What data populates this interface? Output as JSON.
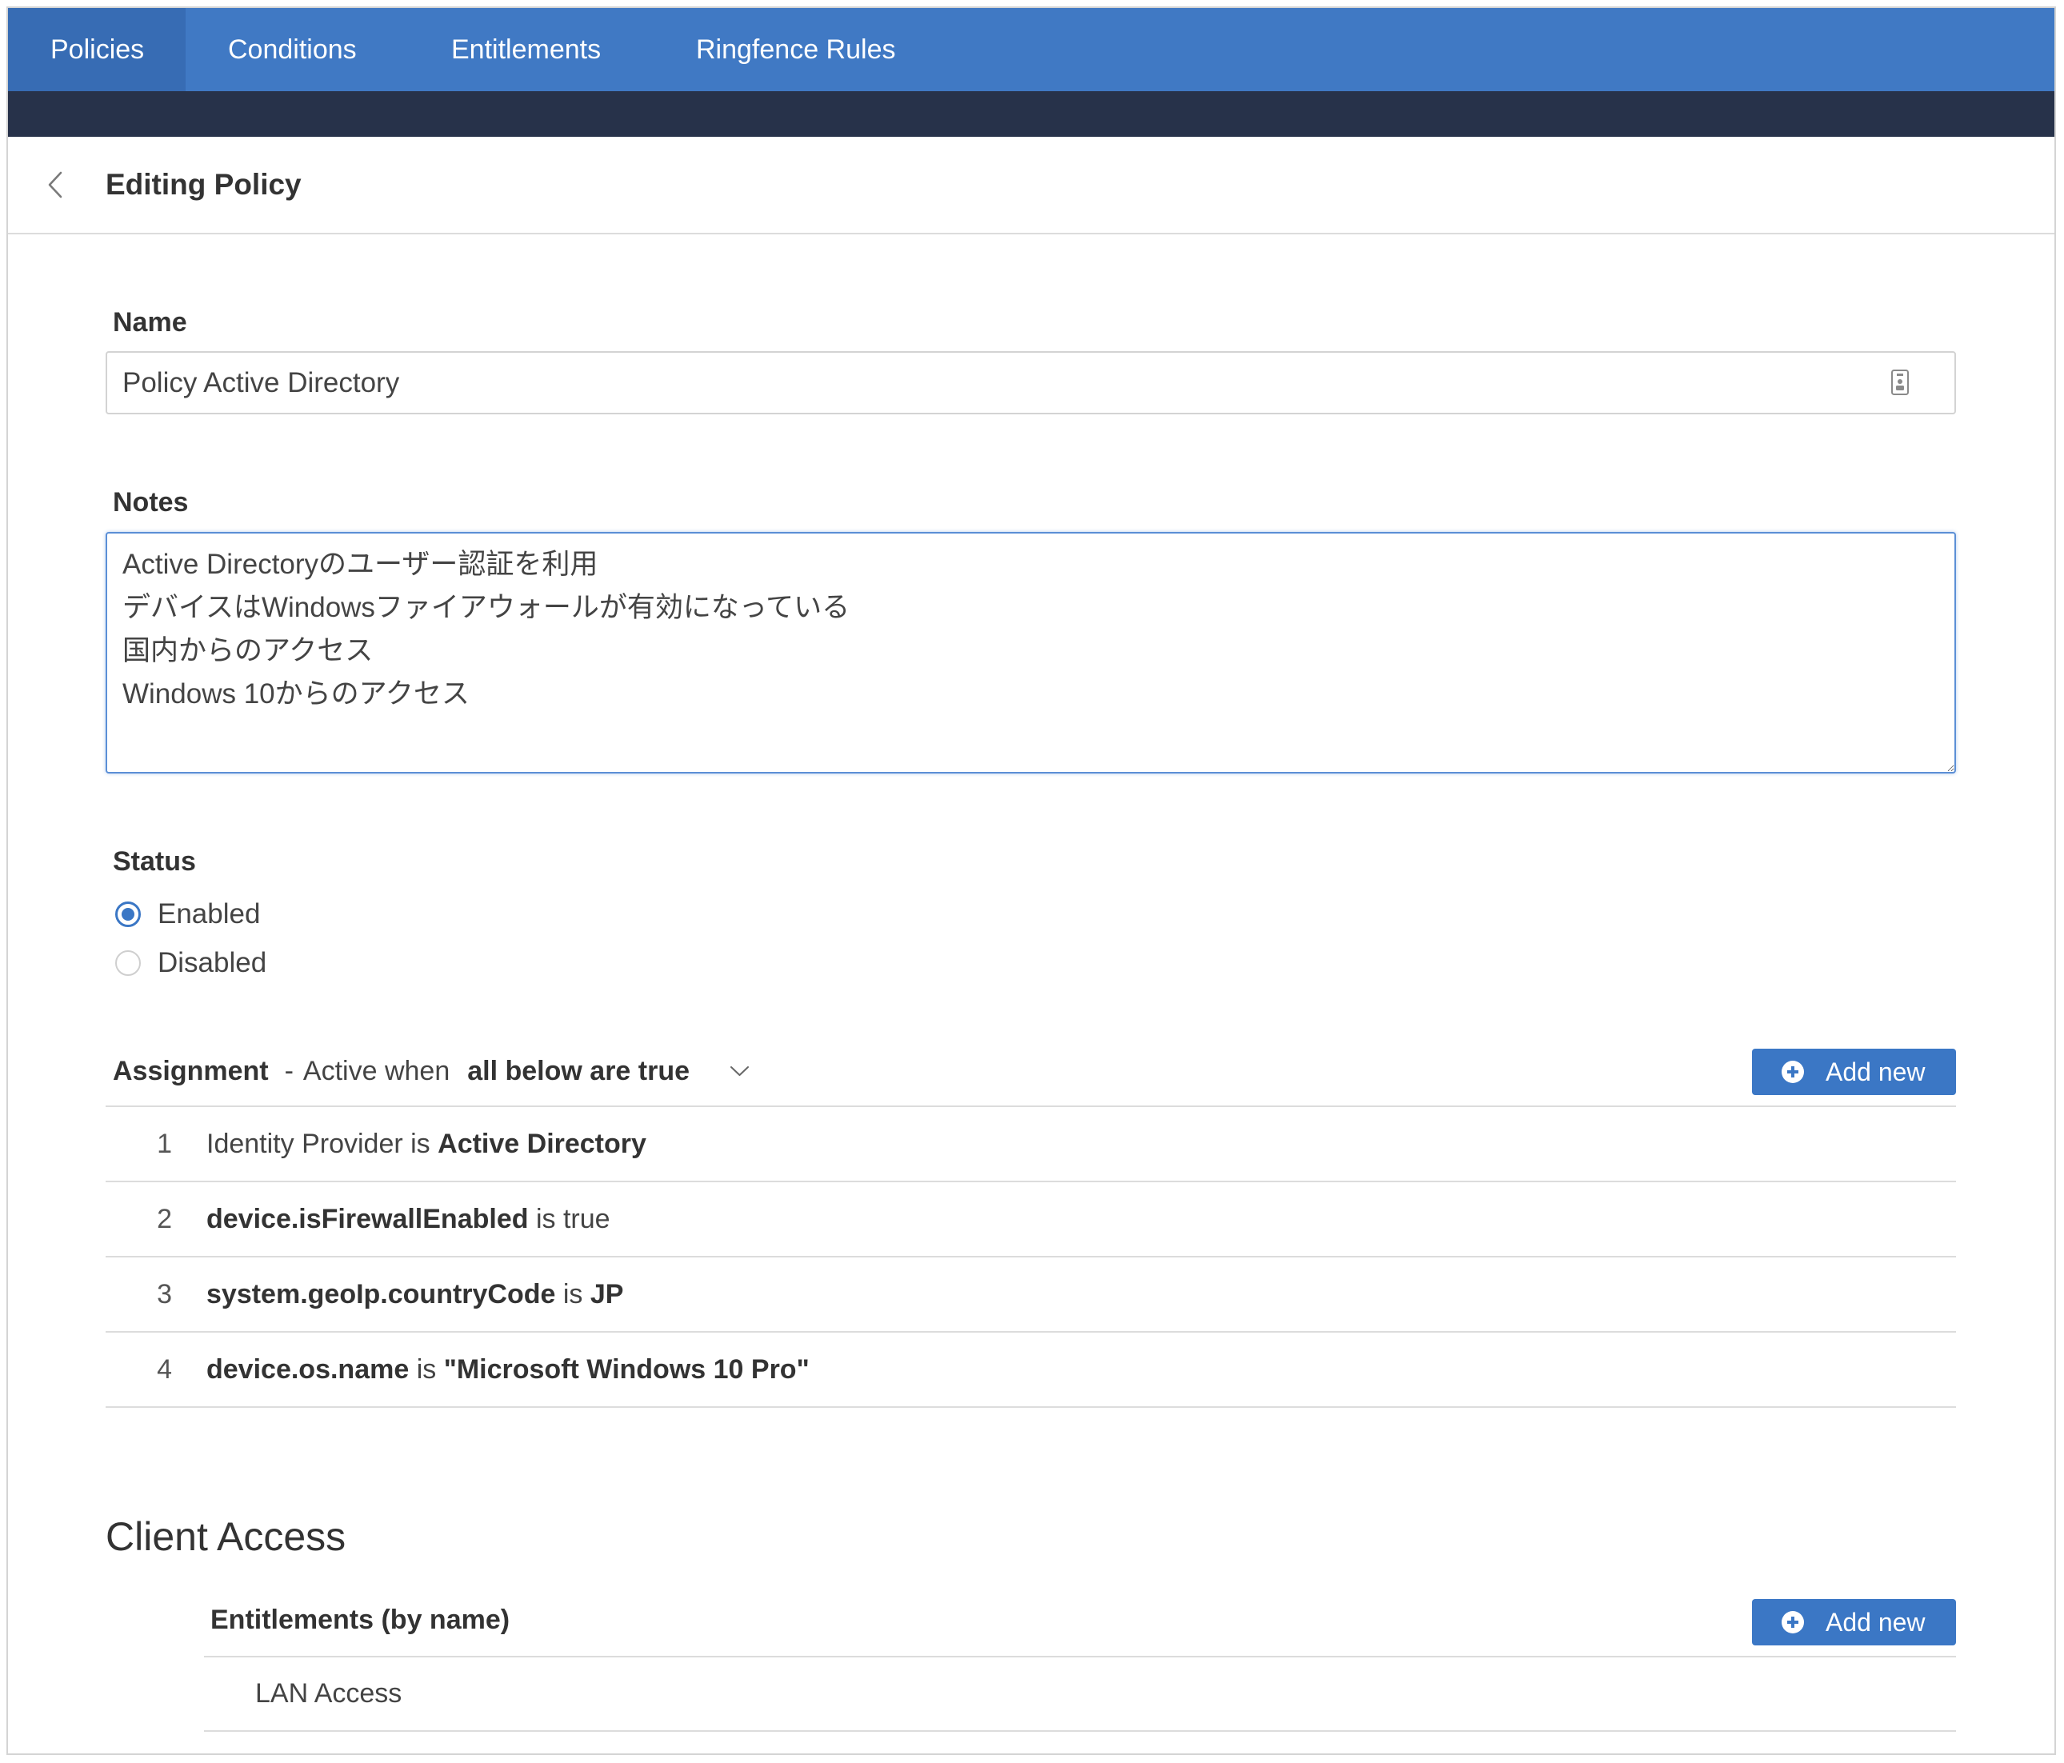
{
  "theme": {
    "nav_bg": "#4079c4",
    "nav_active_bg": "#376cb4",
    "band_bg": "#27324a",
    "accent": "#3b77c5",
    "focus_border": "#5b8fd6",
    "divider": "#dcdcdc"
  },
  "icons": {
    "back": "chevron-left-icon",
    "autofill": "autofill-icon",
    "dropdown": "chevron-down-icon",
    "add": "plus-circle-icon"
  },
  "nav": {
    "tabs": [
      {
        "label": "Policies",
        "active": true
      },
      {
        "label": "Conditions",
        "active": false
      },
      {
        "label": "Entitlements",
        "active": false
      },
      {
        "label": "Ringfence Rules",
        "active": false
      }
    ]
  },
  "header": {
    "title": "Editing Policy"
  },
  "form": {
    "name": {
      "label": "Name",
      "value": "Policy Active Directory"
    },
    "notes": {
      "label": "Notes",
      "value": "Active Directoryのユーザー認証を利用\nデバイスはWindowsファイアウォールが有効になっている\n国内からのアクセス\nWindows 10からのアクセス"
    },
    "status": {
      "label": "Status",
      "options": [
        {
          "label": "Enabled",
          "selected": true
        },
        {
          "label": "Disabled",
          "selected": false
        }
      ]
    }
  },
  "assignment": {
    "label": "Assignment",
    "separator": "-",
    "active_when": "Active when",
    "mode": "all below are true",
    "add_button": "Add new",
    "conditions": [
      {
        "index": "1",
        "subject": "Identity Provider",
        "operator": "is",
        "value": "Active Directory"
      },
      {
        "index": "2",
        "subject": "device.isFirewallEnabled",
        "operator": "is",
        "value": "true"
      },
      {
        "index": "3",
        "subject": "system.geoIp.countryCode",
        "operator": "is",
        "value": "JP"
      },
      {
        "index": "4",
        "subject": "device.os.name",
        "operator": "is",
        "value": "\"Microsoft Windows 10 Pro\""
      }
    ]
  },
  "client_access": {
    "title": "Client Access",
    "entitlements": {
      "label": "Entitlements (by name)",
      "add_button": "Add new",
      "items": [
        "LAN Access"
      ]
    }
  }
}
